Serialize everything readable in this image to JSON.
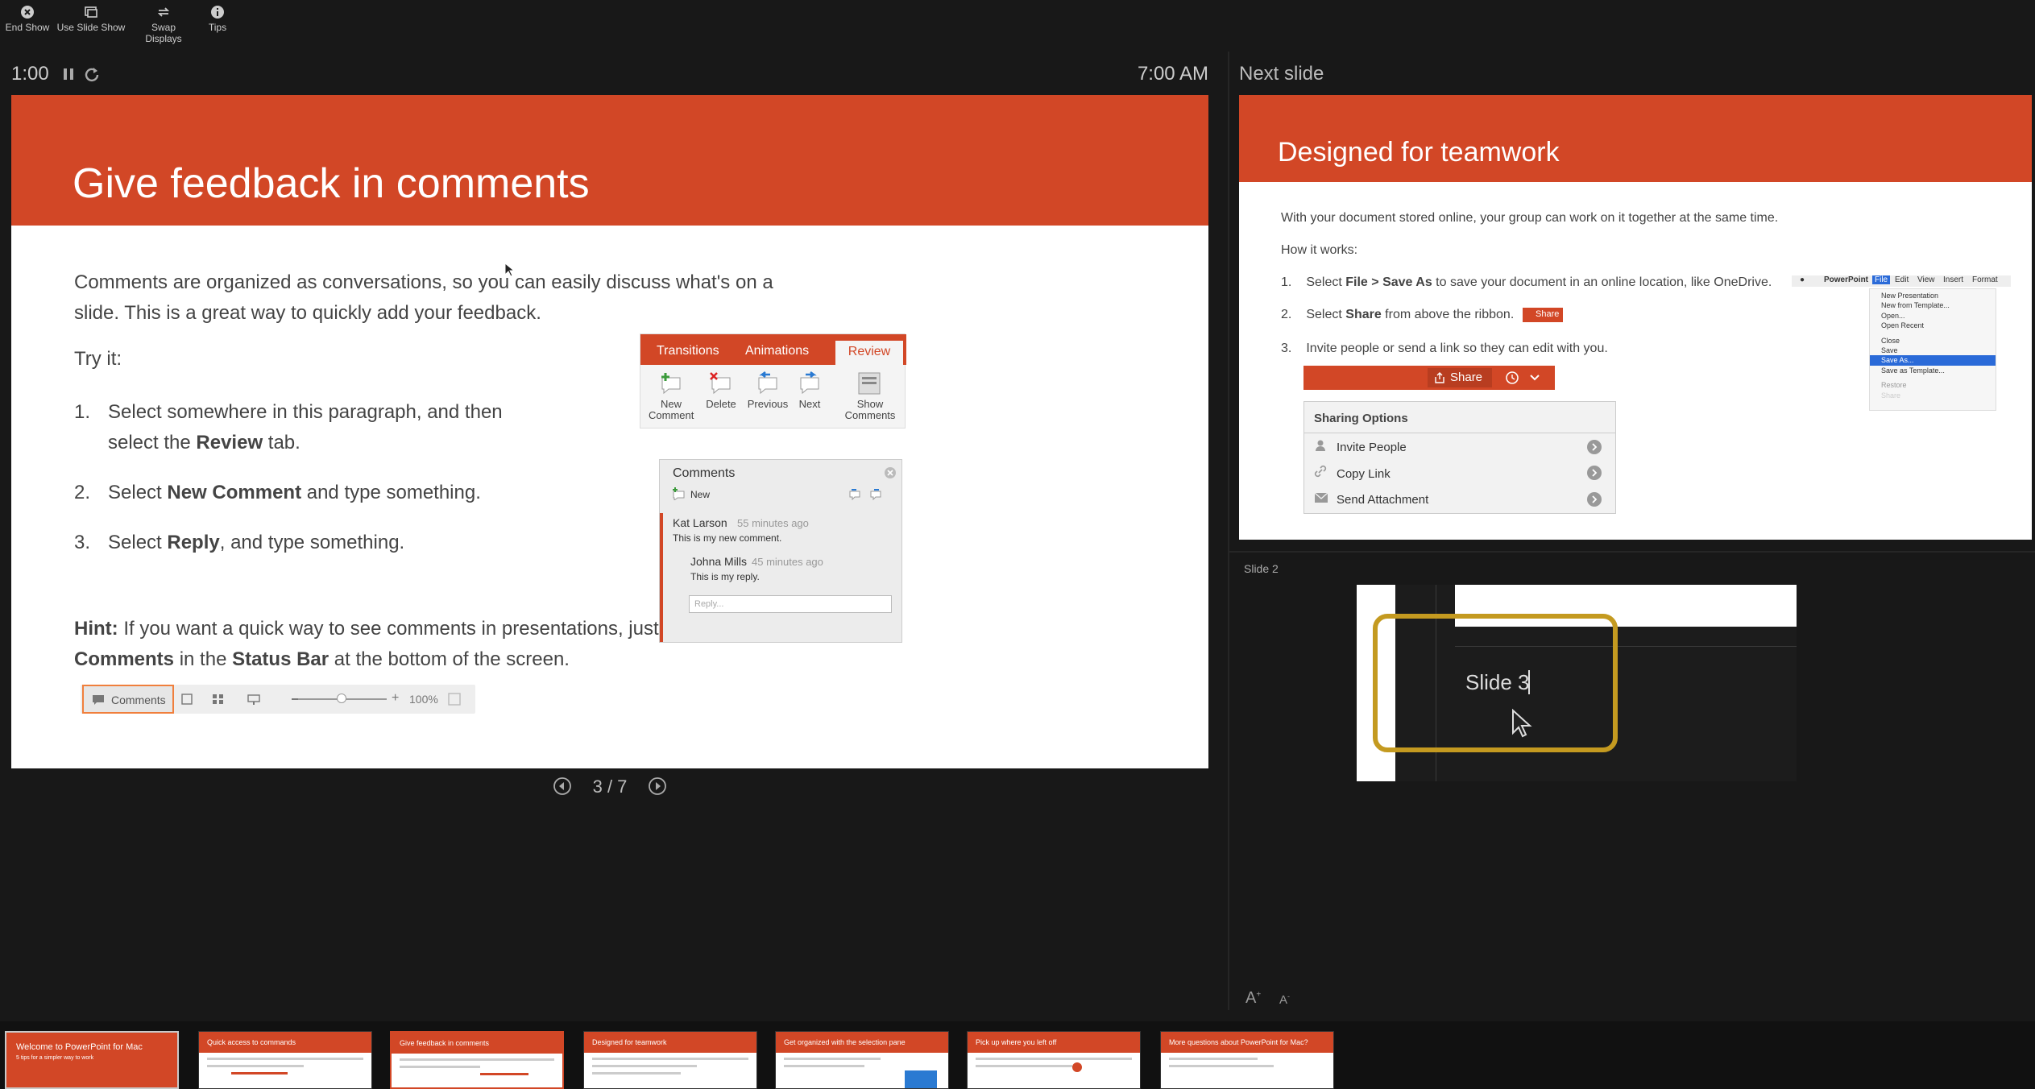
{
  "toolbar": {
    "end_show": "End Show",
    "use_slide_show": "Use Slide Show",
    "swap_displays": "Swap Displays",
    "tips": "Tips"
  },
  "timer": {
    "elapsed": "1:00",
    "clock": "7:00 AM"
  },
  "current_slide": {
    "title": "Give feedback in comments",
    "intro": "Comments are organized as conversations, so you can easily discuss what's on a slide. This is a great way to quickly add your feedback.",
    "try_it": "Try it:",
    "step1_a": "Select somewhere in this paragraph, and then select the ",
    "step1_b": "Review",
    "step1_c": " tab.",
    "step2_a": "Select ",
    "step2_b": "New Comment",
    "step2_c": " and type something.",
    "step3_a": "Select ",
    "step3_b": "Reply",
    "step3_c": ", and type something.",
    "hint_label": "Hint:",
    "hint_a": " If you want a quick way to see comments in presentations, just select ",
    "hint_b": "Comments",
    "hint_c": " in the ",
    "hint_d": "Status Bar",
    "hint_e": " at the bottom of the screen.",
    "ribbon": {
      "tabs": [
        "Transitions",
        "Animations",
        "Review"
      ],
      "buttons": [
        "New Comment",
        "Delete",
        "Previous",
        "Next",
        "Show Comments"
      ]
    },
    "comments_pane": {
      "title": "Comments",
      "new": "New",
      "author1": "Kat Larson",
      "time1": "55 minutes ago",
      "text1": "This is my new comment.",
      "author2": "Johna Mills",
      "time2": "45 minutes ago",
      "text2": "This is my reply.",
      "reply_placeholder": "Reply..."
    },
    "status_bar": {
      "comments": "Comments",
      "zoom": "100%"
    }
  },
  "navigation": {
    "page": "3 / 7"
  },
  "next_slide": {
    "label": "Next slide",
    "title": "Designed for teamwork",
    "intro": "With your document stored online, your group can work on it together at the same time.",
    "how": "How it works:",
    "s1_a": "Select ",
    "s1_b": "File > Save As",
    "s1_c": " to save your document in an online location, like OneDrive.",
    "s2_a": "Select ",
    "s2_b": "Share",
    "s2_c": " from above the ribbon.",
    "s3": "Invite people or send a link so they can edit with you.",
    "share_btn": "Share",
    "sharing_title": "Sharing Options",
    "share_opts": [
      "Invite People",
      "Copy Link",
      "Send Attachment"
    ],
    "menubar": [
      "PowerPoint",
      "File",
      "Edit",
      "View",
      "Insert",
      "Format"
    ],
    "file_menu": [
      "New Presentation",
      "New from Template...",
      "Open...",
      "Open Recent",
      "Close",
      "Save",
      "Save As...",
      "Save as Template...",
      "Restore",
      "Share"
    ]
  },
  "notes": {
    "label": "Slide 2",
    "slide_text": "Slide 3"
  },
  "thumbnails": [
    {
      "title": "Welcome to PowerPoint for Mac",
      "sub": "5 tips for a simpler way to work"
    },
    {
      "title": "Quick access to commands"
    },
    {
      "title": "Give feedback in comments"
    },
    {
      "title": "Designed for teamwork"
    },
    {
      "title": "Get organized with the selection pane"
    },
    {
      "title": "Pick up where you left off"
    },
    {
      "title": "More questions about PowerPoint for Mac?"
    }
  ],
  "colors": {
    "accent": "#d24726",
    "background": "#181818",
    "highlight": "#c49a20"
  }
}
